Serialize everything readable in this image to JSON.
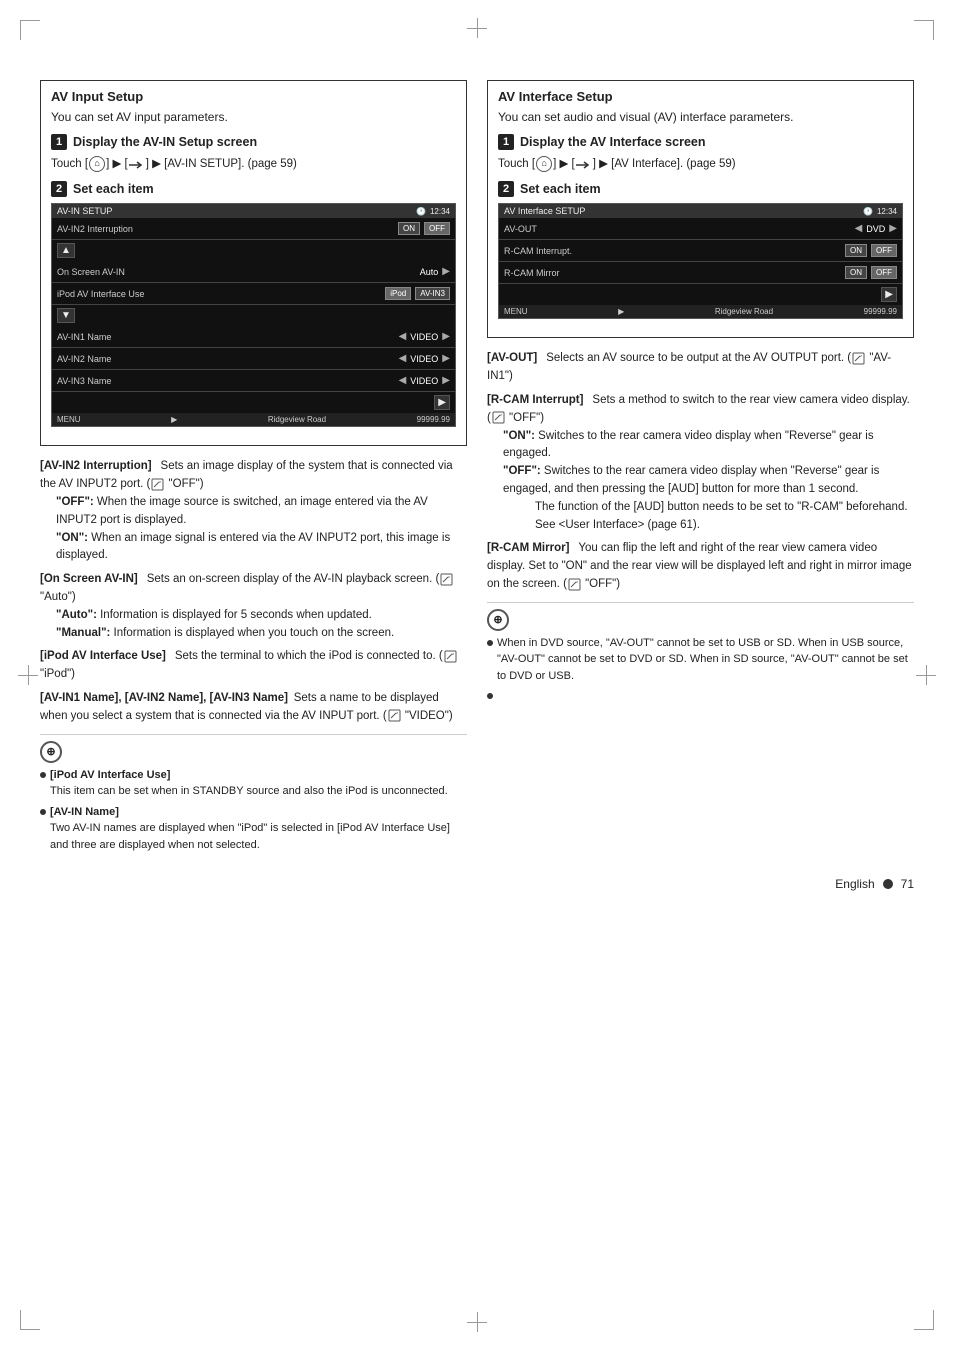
{
  "page": {
    "language": "English",
    "page_number": "71"
  },
  "left_section": {
    "title": "AV Input Setup",
    "intro": "You can set AV input parameters.",
    "step1": {
      "label": "Display the AV-IN Setup screen",
      "touch_text": "Touch [",
      "touch_text2": "] ▶ [",
      "touch_text3": "] ▶ [AV-IN SETUP]. (page 59)"
    },
    "step2": {
      "label": "Set each item"
    },
    "screen": {
      "title": "AV-IN SETUP",
      "rows": [
        {
          "label": "AV-IN2 Interruption",
          "value": "",
          "type": "on_off",
          "on": "ON",
          "off": "OFF"
        },
        {
          "label": "On Screen AV-IN",
          "value": "Auto",
          "type": "arrow"
        },
        {
          "label": "iPod AV Interface Use",
          "value1": "iPod",
          "value2": "AV-IN3",
          "type": "dual"
        },
        {
          "label": "AV-IN1 Name",
          "value": "VIDEO",
          "type": "arrow"
        },
        {
          "label": "AV-IN2 Name",
          "value": "VIDEO",
          "type": "arrow"
        },
        {
          "label": "AV-IN3 Name",
          "value": "VIDEO",
          "type": "arrow"
        }
      ],
      "footer": "Ridgeview Road",
      "footer_value": "99999.99"
    },
    "descriptions": [
      {
        "term": "[AV-IN2 Interruption]",
        "text": "  Sets an image display of the system that is connected via the AV INPUT2 port. (",
        "default": "\"OFF\"",
        "text_end": ")",
        "sub_items": [
          {
            "label": "\"OFF\":",
            "text": " When the image source is switched, an image entered via the AV INPUT2 port is displayed."
          },
          {
            "label": "\"ON\":",
            "text": " When an image signal is entered via the AV INPUT2 port, this image is displayed."
          }
        ]
      },
      {
        "term": "[On Screen AV-IN]",
        "text": "  Sets an on-screen display of the AV-IN playback screen. (",
        "default": "\"Auto\"",
        "text_end": ")",
        "sub_items": [
          {
            "label": "\"Auto\":",
            "text": " Information is displayed for 5 seconds when updated."
          },
          {
            "label": "\"Manual\":",
            "text": " Information is displayed when you touch on the screen."
          }
        ]
      },
      {
        "term": "[iPod AV Interface Use]",
        "text": "  Sets the terminal to which the iPod is connected to. (",
        "default": "\"iPod\"",
        "text_end": ")"
      },
      {
        "term": "[AV-IN1 Name], [AV-IN2 Name], [AV-IN3 Name]",
        "text": "  Sets a name to be displayed when you select a system that is connected via the AV INPUT port. (",
        "default": "\"VIDEO\"",
        "text_end": ")"
      }
    ],
    "notes": [
      {
        "bullet": true,
        "title": "[iPod AV Interface Use]",
        "text": "This item can be set when in STANDBY source and also the iPod is unconnected."
      },
      {
        "bullet": true,
        "title": "[AV-IN Name]",
        "text": "Two AV-IN names are displayed when \"iPod\" is selected in [iPod AV Interface Use] and three are displayed when not selected."
      }
    ]
  },
  "right_section": {
    "title": "AV Interface Setup",
    "intro": "You can set audio and visual (AV) interface parameters.",
    "step1": {
      "label": "Display the AV Interface screen",
      "touch_text": "Touch [",
      "touch_text2": "] ▶ [",
      "touch_text3": "] ▶ [AV Interface]. (page 59)"
    },
    "step2": {
      "label": "Set each item"
    },
    "screen": {
      "title": "AV Interface SETUP",
      "rows": [
        {
          "label": "AV-OUT",
          "value": "DVD",
          "type": "arrow_both"
        },
        {
          "label": "R-CAM Interrupt.",
          "value": "",
          "type": "on_off",
          "on": "ON",
          "off": "OFF"
        },
        {
          "label": "R-CAM Mirror",
          "value": "",
          "type": "on_off",
          "on": "ON",
          "off": "OFF"
        }
      ],
      "footer": "Ridgeview Road",
      "footer_value": "99999.99"
    },
    "descriptions": [
      {
        "term": "[AV-OUT]",
        "text": "  Selects an AV source to be output at the AV OUTPUT port. (",
        "default": "\"AV-IN1\"",
        "text_end": ")"
      },
      {
        "term": "[R-CAM Interrupt]",
        "text": "  Sets a method to switch to the rear view camera video display. (",
        "default": "\"OFF\"",
        "text_end": ")",
        "sub_items": [
          {
            "label": "\"ON\":",
            "text": " Switches to the rear camera video display when \"Reverse\" gear is engaged."
          },
          {
            "label": "\"OFF\":",
            "text": " Switches to the rear camera video display when \"Reverse\" gear is engaged, and then pressing the [AUD] button for more than 1 second. The function of the [AUD] button needs to be set to \"R-CAM\" beforehand. See <User Interface> (page 61)."
          }
        ]
      },
      {
        "term": "[R-CAM Mirror]",
        "text": "  You can flip the left and right of the rear view camera video display. Set to \"ON\" and the rear view will be displayed left and right in mirror image on the screen. (",
        "default": "\"OFF\"",
        "text_end": ")"
      }
    ],
    "notes": [
      {
        "bullet": true,
        "text": "When in DVD source, \"AV-OUT\" cannot be set to USB or SD. When in USB source, \"AV-OUT\" cannot be set to DVD or SD. When in SD source, \"AV-OUT\" cannot be set to DVD or USB."
      },
      {
        "bullet": true,
        "text": ""
      }
    ]
  }
}
